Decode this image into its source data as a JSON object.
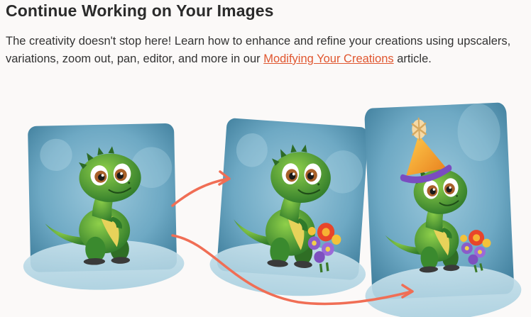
{
  "article": {
    "heading": "Continue Working on Your Images",
    "intro_before": "The creativity doesn't stop here! Learn how to enhance and refine your creations using upscalers, variations, zoom out, pan, editor, and more in our ",
    "intro_link": "Modifying Your Creations",
    "intro_after": " article."
  },
  "illustration": {
    "cards": [
      {
        "name": "original-dino-image",
        "content": "baby dinosaur"
      },
      {
        "name": "dino-with-flowers-image",
        "content": "baby dinosaur holding flowers"
      },
      {
        "name": "dino-with-party-hat-image",
        "content": "baby dinosaur with party hat and flowers"
      }
    ],
    "colors": {
      "card_bg": "#6ea9c4",
      "dino": "#4a9a32",
      "arrow": "#f06e55",
      "link": "#e0562f",
      "hat": "#f2a12e"
    }
  }
}
